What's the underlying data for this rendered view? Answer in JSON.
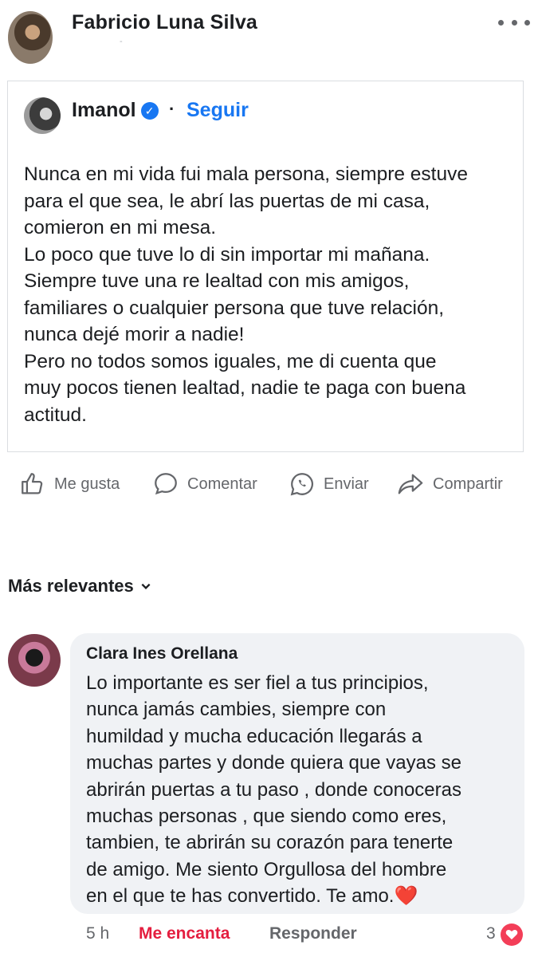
{
  "post": {
    "author_name": "Fabricio Luna Silva",
    "header_sub": "-",
    "shared": {
      "author_name": "Imanol",
      "follow_label": "Seguir",
      "separator": "·",
      "text": "Nunca en mi vida fui mala persona, siempre estuve\npara el que sea, le abrí las puertas de mi casa,\ncomieron en mi mesa.\nLo poco que tuve lo di sin importar mi mañana.\nSiempre tuve una re lealtad con mis amigos,\nfamiliares o cualquier persona que tuve relación,\nnunca dejé morir a nadie!\nPero no todos somos iguales, me di cuenta que\nmuy pocos tienen lealtad, nadie te paga con buena\nactitud."
    }
  },
  "actions": {
    "like": "Me gusta",
    "comment": "Comentar",
    "send": "Enviar",
    "share": "Compartir"
  },
  "comments": {
    "sort_label": "Más relevantes",
    "items": [
      {
        "name": "Clara Ines Orellana",
        "text": "Lo importante es ser fiel a tus principios,\nnunca jamás cambies, siempre con\nhumildad y mucha educación  llegarás a\nmuchas partes y donde quiera que vayas se\nabrirán puertas a tu paso ,  donde conoceras\nmuchas personas , que siendo como eres,\ntambien, te abrirán su corazón para tenerte\nde amigo.  Me siento Orgullosa del hombre\nen el que te has convertido. Te amo.",
        "emoji": "❤️",
        "time": "5 h",
        "reaction_label": "Me encanta",
        "reply_label": "Responder",
        "reaction_count": "3"
      }
    ]
  },
  "colors": {
    "link_blue": "#1877f2",
    "love_red": "#e41e3f",
    "muted": "#65676b",
    "bubble": "#f0f2f5"
  }
}
